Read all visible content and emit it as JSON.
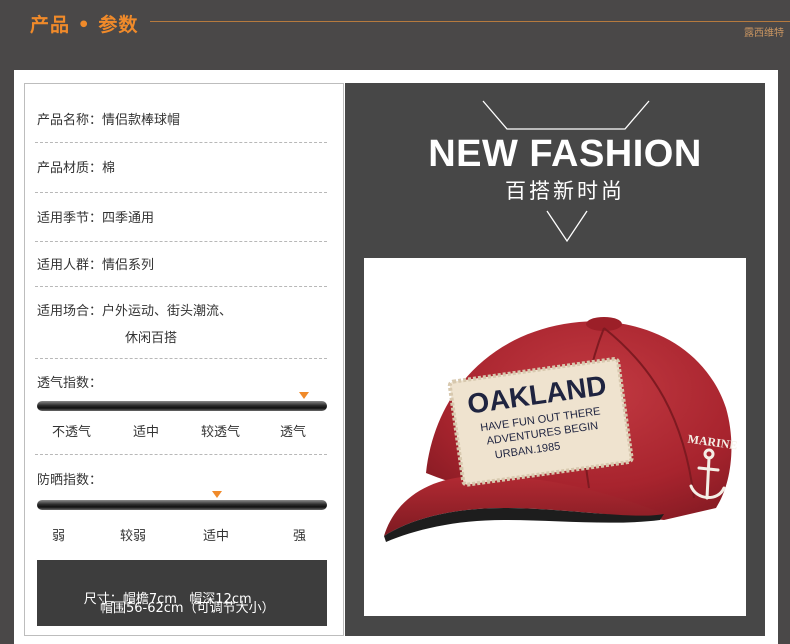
{
  "header": {
    "title": "产品 • 参数",
    "brand": "露西维特"
  },
  "specs": {
    "name_label": "产品名称：",
    "name_value": "情侣款棒球帽",
    "material_label": "产品材质：",
    "material_value": "棉",
    "season_label": "适用季节：",
    "season_value": "四季通用",
    "people_label": "适用人群：",
    "people_value": "情侣系列",
    "occasion_label": "适用场合：",
    "occasion_value_line1": "户外运动、街头潮流、",
    "occasion_value_line2": "休闲百搭"
  },
  "breathability": {
    "label": "透气指数：",
    "ticks": [
      "不透气",
      "适中",
      "较透气",
      "透气"
    ],
    "level": 0.92
  },
  "sun_protection": {
    "label": "防晒指数：",
    "ticks": [
      "弱",
      "较弱",
      "适中",
      "强"
    ],
    "level": 0.62
  },
  "size": {
    "label": "尺寸：",
    "line1": "帽檐7cm   帽深12cm",
    "line2": "帽围56-62cm（可调节大小）"
  },
  "promo": {
    "title": "NEW FASHION",
    "subtitle": "百搭新时尚"
  },
  "cap": {
    "patch_main": "OAKLAND",
    "patch_line1": "HAVE FUN OUT THERE",
    "patch_line2": "ADVENTURES BEGIN",
    "patch_line3": "URBAN.1985",
    "side_text": "MARINE",
    "color": "#a8242e"
  }
}
